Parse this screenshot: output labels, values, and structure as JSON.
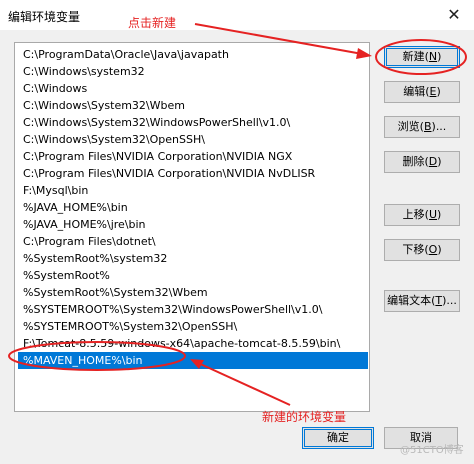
{
  "window": {
    "title": "编辑环境变量",
    "close_glyph": "✕"
  },
  "path_list": [
    "C:\\ProgramData\\Oracle\\Java\\javapath",
    "C:\\Windows\\system32",
    "C:\\Windows",
    "C:\\Windows\\System32\\Wbem",
    "C:\\Windows\\System32\\WindowsPowerShell\\v1.0\\",
    "C:\\Windows\\System32\\OpenSSH\\",
    "C:\\Program Files\\NVIDIA Corporation\\NVIDIA NGX",
    "C:\\Program Files\\NVIDIA Corporation\\NVIDIA NvDLISR",
    "F:\\Mysql\\bin",
    "%JAVA_HOME%\\bin",
    "%JAVA_HOME%\\jre\\bin",
    "C:\\Program Files\\dotnet\\",
    "%SystemRoot%\\system32",
    "%SystemRoot%",
    "%SystemRoot%\\System32\\Wbem",
    "%SYSTEMROOT%\\System32\\WindowsPowerShell\\v1.0\\",
    "%SYSTEMROOT%\\System32\\OpenSSH\\",
    "F:\\Tomcat-8.5.59-windows-x64\\apache-tomcat-8.5.59\\bin\\",
    "%MAVEN_HOME%\\bin"
  ],
  "selected_index": 18,
  "buttons": {
    "new": {
      "label": "新建",
      "mnemonic": "N"
    },
    "edit": {
      "label": "编辑",
      "mnemonic": "E"
    },
    "browse": {
      "label": "浏览",
      "mnemonic": "B",
      "suffix": "..."
    },
    "delete": {
      "label": "删除",
      "mnemonic": "D"
    },
    "move_up": {
      "label": "上移",
      "mnemonic": "U"
    },
    "move_down": {
      "label": "下移",
      "mnemonic": "O"
    },
    "edit_text": {
      "label": "编辑文本",
      "mnemonic": "T",
      "suffix": "..."
    },
    "ok": {
      "label": "确定"
    },
    "cancel": {
      "label": "取消"
    }
  },
  "annotations": {
    "click_new": "点击新建",
    "new_env_var": "新建的环境变量",
    "color": "#e52222"
  },
  "watermark": "@51CTO博客"
}
